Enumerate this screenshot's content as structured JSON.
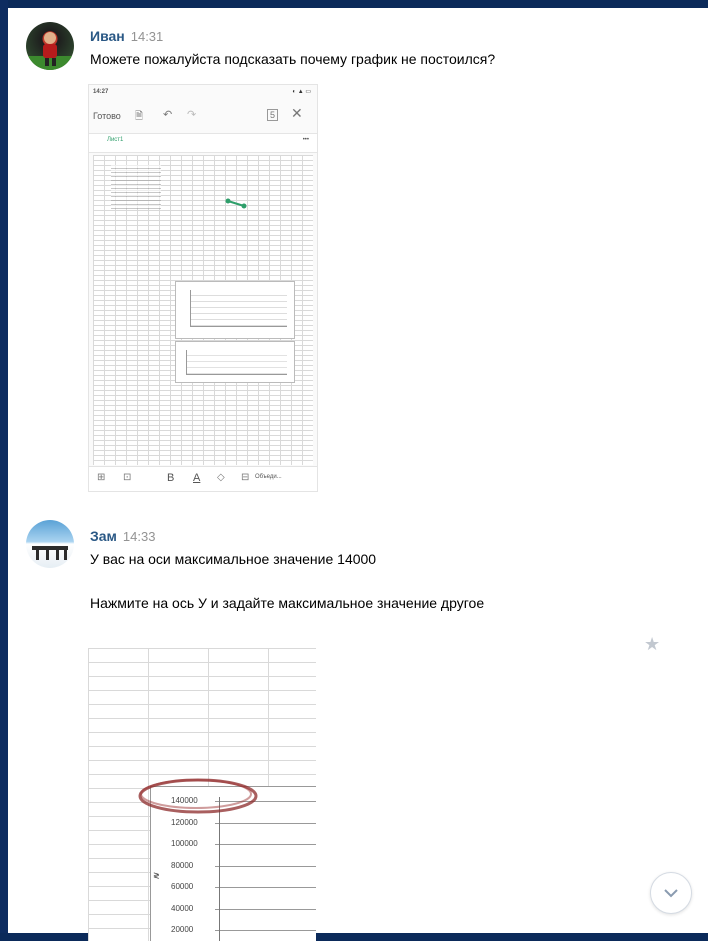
{
  "messages": [
    {
      "author": "Иван",
      "time": "14:31",
      "text": "Можете пожалуйста подсказать почему график не постоился?",
      "attachment": {
        "status_time": "14:27",
        "toolbar_done": "Готово",
        "sheet_tab": "Лист1",
        "more": "•••",
        "bottom_toolbar": {
          "bold": "B",
          "text_color": "A",
          "merge": "Объеди..."
        }
      }
    },
    {
      "author": "Зам",
      "time": "14:33",
      "text_lines": [
        "У вас на оси максимальное значение 14000",
        "Нажмите на ось У и задайте максимальное значение другое"
      ],
      "attachment": {
        "y_ticks": [
          "140000",
          "120000",
          "100000",
          "80000",
          "60000",
          "40000",
          "20000"
        ],
        "axis_char": "≷"
      }
    }
  ],
  "icons": {
    "star": "star-icon",
    "scroll_down": "chevron-down-icon"
  }
}
